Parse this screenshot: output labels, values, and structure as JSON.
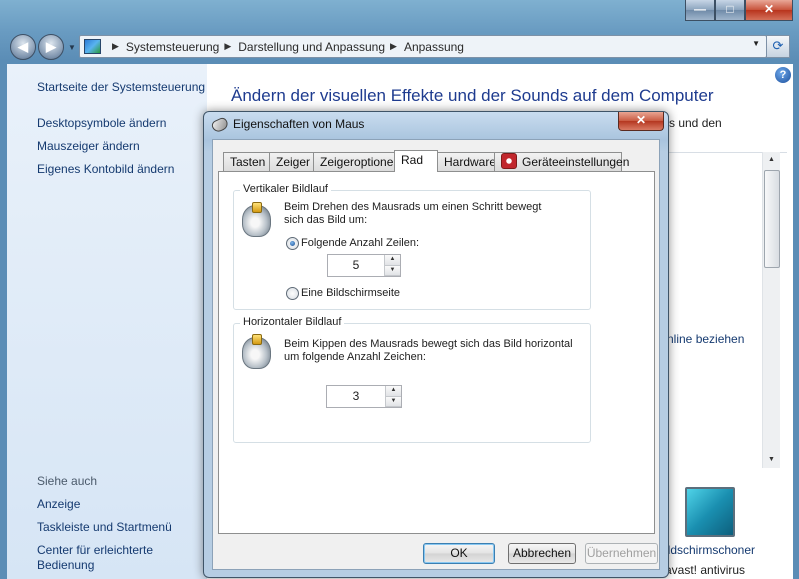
{
  "window": {
    "caption_buttons": {
      "minimize": "—",
      "maximize": "□",
      "close": "✕"
    },
    "nav": {
      "back": "◀",
      "forward": "▶"
    },
    "address": {
      "icon": "control-panel-icon",
      "breadcrumbs": [
        "Systemsteuerung",
        "Darstellung und Anpassung",
        "Anpassung"
      ]
    },
    "help": "?"
  },
  "sidebar": {
    "home_link": "Startseite der Systemsteuerung",
    "links": [
      "Desktopsymbole ändern",
      "Mauszeiger ändern",
      "Eigenes Kontobild ändern"
    ],
    "see_also_heading": "Siehe auch",
    "see_also": [
      "Anzeige",
      "Taskleiste und Startmenü",
      "Center für erleichterte",
      "Bedienung"
    ]
  },
  "main": {
    "title": "Ändern der visuellen Effekte und der Sounds auf dem Computer",
    "partial_text": "s und den",
    "online_link": "nline beziehen",
    "screensaver_label": "ildschirmschoner",
    "screensaver_sub": "avast! antivirus"
  },
  "dialog": {
    "title": "Eigenschaften von Maus",
    "close": "✕",
    "tabs": [
      "Tasten",
      "Zeiger",
      "Zeigeroptionen",
      "Rad",
      "Hardware",
      "Geräteeinstellungen"
    ],
    "active_tab": "Rad",
    "vertical": {
      "label": "Vertikaler Bildlauf",
      "description": "Beim Drehen des Mausrads um einen Schritt bewegt sich das Bild um:",
      "option_lines": "Folgende Anzahl Zeilen:",
      "lines_value": "5",
      "option_page": "Eine Bildschirmseite",
      "selected": "lines"
    },
    "horizontal": {
      "label": "Horizontaler Bildlauf",
      "description": "Beim Kippen des Mausrads bewegt sich das Bild horizontal um folgende Anzahl Zeichen:",
      "chars_value": "3"
    },
    "buttons": {
      "ok": "OK",
      "cancel": "Abbrechen",
      "apply": "Übernehmen"
    }
  }
}
